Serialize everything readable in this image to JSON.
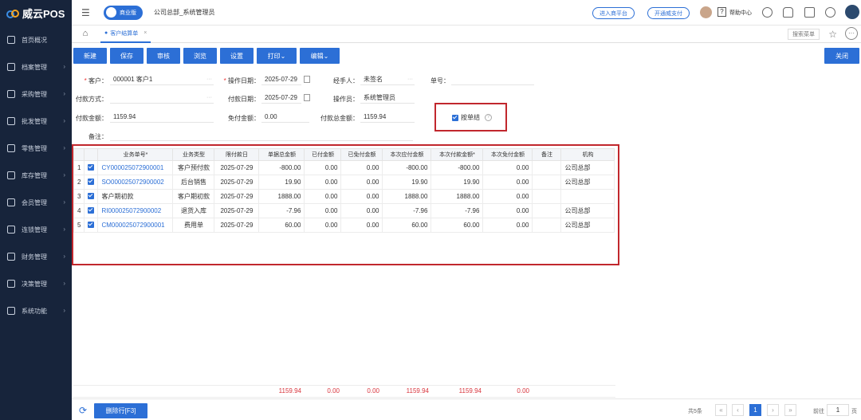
{
  "app": {
    "name": "威云POS",
    "edition": "商业版",
    "org": "公司总部_系统管理员"
  },
  "sidebar": {
    "items": [
      {
        "label": "首页概况",
        "icon": "home-icon"
      },
      {
        "label": "档案管理",
        "icon": "folder-icon"
      },
      {
        "label": "采购管理",
        "icon": "cart-icon"
      },
      {
        "label": "批发管理",
        "icon": "store-icon"
      },
      {
        "label": "零售管理",
        "icon": "cash-icon"
      },
      {
        "label": "库存管理",
        "icon": "warehouse-icon"
      },
      {
        "label": "会员管理",
        "icon": "member-icon"
      },
      {
        "label": "连锁管理",
        "icon": "chain-icon"
      },
      {
        "label": "财务管理",
        "icon": "finance-icon"
      },
      {
        "label": "决策管理",
        "icon": "decision-icon"
      },
      {
        "label": "系统功能",
        "icon": "settings-icon"
      }
    ]
  },
  "header": {
    "enter_platform": "进入商平台",
    "open_pay": "开通威支付",
    "help": "帮助中心"
  },
  "tabs": {
    "active": "客户结算单",
    "search_menu": "搜索菜单"
  },
  "toolbar": {
    "new": "新建",
    "save": "保存",
    "audit": "审核",
    "browse": "浏览",
    "settings": "设置",
    "print": "打印",
    "edit": "编辑",
    "close": "关闭"
  },
  "form": {
    "customer_label": "客户：",
    "customer_value": "000001  客户1",
    "op_date_label": "操作日期：",
    "op_date_value": "2025-07-29",
    "handler_label": "经手人：",
    "handler_value": "未签名",
    "doc_no_label": "单号：",
    "pay_method_label": "付款方式：",
    "pay_date_label": "付款日期：",
    "pay_date_value": "2025-07-29",
    "operator_label": "操作员：",
    "operator_value": "系统管理员",
    "pay_amount_label": "付款金额：",
    "pay_amount_value": "1159.94",
    "free_amount_label": "免付金额：",
    "free_amount_value": "0.00",
    "total_pay_label": "付款总金额：",
    "total_pay_value": "1159.94",
    "remark_label": "备注：",
    "by_bill_label": "按单结"
  },
  "table": {
    "headers": [
      "业务单号*",
      "业务类型",
      "限付款日",
      "单据总金额",
      "已付金额",
      "已免付金额",
      "本次应付金额",
      "本次付款金额*",
      "本次免付金额",
      "备注",
      "机构"
    ],
    "rows": [
      {
        "idx": "1",
        "no": "CY000025072900001",
        "type": "客户预付款",
        "date": "2025-07-29",
        "total": "-800.00",
        "paid": "0.00",
        "freed": "0.00",
        "due": "-800.00",
        "pay": "-800.00",
        "free": "0.00",
        "remark": "",
        "org": "公司总部"
      },
      {
        "idx": "2",
        "no": "SO000025072900002",
        "type": "后台销售",
        "date": "2025-07-29",
        "total": "19.90",
        "paid": "0.00",
        "freed": "0.00",
        "due": "19.90",
        "pay": "19.90",
        "free": "0.00",
        "remark": "",
        "org": "公司总部"
      },
      {
        "idx": "3",
        "no": "客户期初款",
        "type": "客户期初款",
        "date": "2025-07-29",
        "total": "1888.00",
        "paid": "0.00",
        "freed": "0.00",
        "due": "1888.00",
        "pay": "1888.00",
        "free": "0.00",
        "remark": "",
        "org": ""
      },
      {
        "idx": "4",
        "no": "RI000025072900002",
        "type": "退货入库",
        "date": "2025-07-29",
        "total": "-7.96",
        "paid": "0.00",
        "freed": "0.00",
        "due": "-7.96",
        "pay": "-7.96",
        "free": "0.00",
        "remark": "",
        "org": "公司总部"
      },
      {
        "idx": "5",
        "no": "CM000025072900001",
        "type": "费用单",
        "date": "2025-07-29",
        "total": "60.00",
        "paid": "0.00",
        "freed": "0.00",
        "due": "60.00",
        "pay": "60.00",
        "free": "0.00",
        "remark": "",
        "org": "公司总部"
      }
    ],
    "sums": {
      "total": "1159.94",
      "paid": "0.00",
      "freed": "0.00",
      "due": "1159.94",
      "pay": "1159.94",
      "free": "0.00"
    }
  },
  "footer": {
    "delete_row": "删除行[F3]",
    "count": "共5条",
    "page": "1",
    "goto_label": "前往",
    "goto_value": "1",
    "page_unit": "页"
  },
  "colors": {
    "primary": "#2c6fd6",
    "sidebar": "#17243b",
    "highlight": "#c1272d",
    "sum": "#d9363e"
  }
}
